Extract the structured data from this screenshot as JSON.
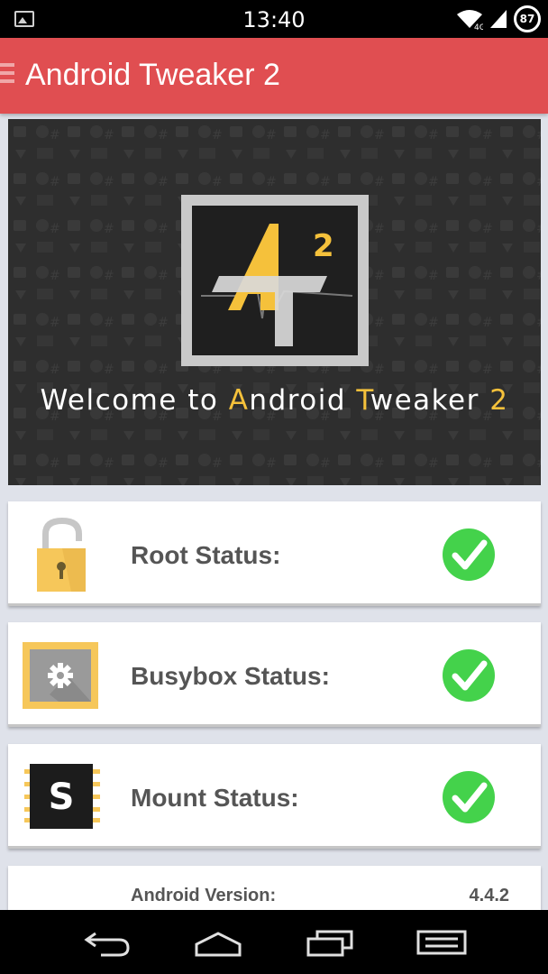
{
  "status_bar": {
    "time": "13:40",
    "battery": "87",
    "icons": [
      "image-notification-icon",
      "wifi-icon",
      "signal-icon",
      "battery-icon"
    ]
  },
  "app_bar": {
    "title": "Android Tweaker 2",
    "menu_icon": "menu-icon"
  },
  "banner": {
    "welcome_parts": [
      "Welcome to ",
      "A",
      "ndroid ",
      "T",
      "weaker ",
      "2"
    ],
    "logo": "Android Tweaker 2 logo"
  },
  "status_cards": [
    {
      "label": "Root Status:",
      "icon": "unlocked-padlock-icon",
      "status": "ok"
    },
    {
      "label": "Busybox Status:",
      "icon": "busybox-gear-icon",
      "status": "ok"
    },
    {
      "label": "Mount Status:",
      "icon": "mount-chip-icon",
      "status": "ok"
    }
  ],
  "info_card": {
    "label": "Android Version:",
    "value": "4.4.2"
  },
  "nav_bar": {
    "buttons": [
      "back-icon",
      "home-icon",
      "recents-icon",
      "menu-icon"
    ]
  },
  "colors": {
    "app_bar": "#e04e51",
    "accent_yellow": "#f5c13b",
    "check_green": "#44d24b",
    "background": "#dfe2ea"
  }
}
